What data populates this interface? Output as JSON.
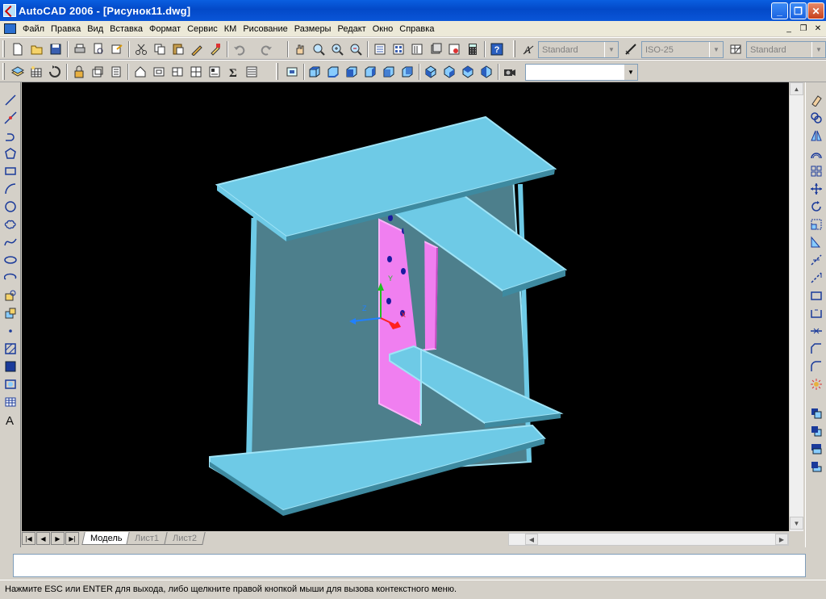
{
  "window": {
    "title": "AutoCAD 2006 - [Рисунок11.dwg]",
    "minimize_label": "_",
    "maximize_label": "❐",
    "close_label": "✕"
  },
  "menu": {
    "items": [
      "Файл",
      "Правка",
      "Вид",
      "Вставка",
      "Формат",
      "Сервис",
      "КМ",
      "Рисование",
      "Размеры",
      "Редакт",
      "Окно",
      "Справка"
    ],
    "mdi_minimize": "_",
    "mdi_restore": "❐",
    "mdi_close": "✕"
  },
  "toolbar": {
    "text_style": "Standard",
    "dim_style": "ISO-25",
    "table_style": "Standard",
    "view_combo": ""
  },
  "tabs": {
    "items": [
      "Модель",
      "Лист1",
      "Лист2"
    ],
    "active": "Модель"
  },
  "status": {
    "message": "Нажмите ESC или ENTER для выхода, либо щелкните правой кнопкой мыши для вызова контекстного меню."
  },
  "colors": {
    "titlebar": "#0a5fe0",
    "viewport_bg": "#000000",
    "steel": "#6ecae6",
    "steel_edge": "#9fe4f7",
    "web_shadow": "#4d7f8c",
    "plate": "#f07ff0",
    "bolt": "#1a1aa0"
  },
  "ucs": {
    "x_label": "X",
    "y_label": "Y",
    "z_label": "Z"
  }
}
